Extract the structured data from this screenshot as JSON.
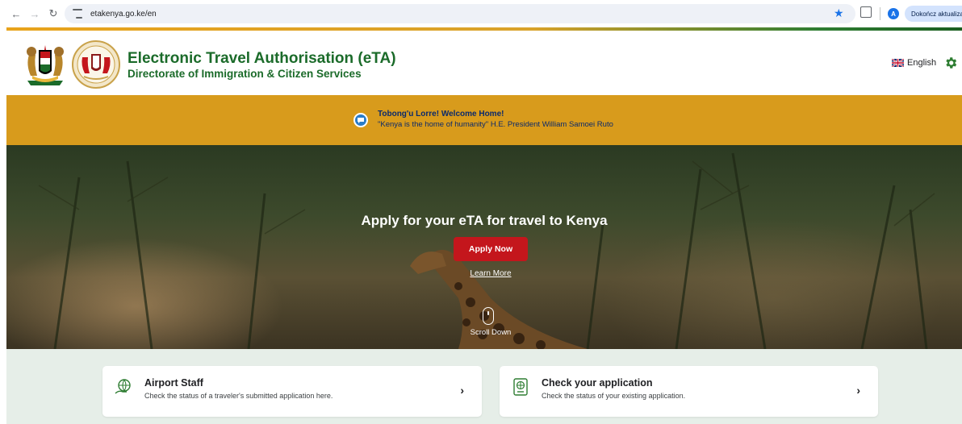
{
  "browser": {
    "url": "etakenya.go.ke/en",
    "update_button": "Dokończ aktualizację",
    "profile_initial": "A"
  },
  "header": {
    "title": "Electronic Travel Authorisation (eTA)",
    "subtitle": "Directorate of Immigration & Citizen Services",
    "language": "English"
  },
  "banner": {
    "title": "Tobong'u Lorre! Welcome Home!",
    "quote": "\"Kenya is the home of humanity\" H.E. President William Samoei Ruto"
  },
  "hero": {
    "title": "Apply for your eTA for travel to Kenya",
    "apply_label": "Apply Now",
    "learn_more_label": "Learn More",
    "scroll_label": "Scroll Down"
  },
  "cards": [
    {
      "title": "Airport Staff",
      "description": "Check the status of a traveler's submitted application here.",
      "icon": "globe-hand-icon"
    },
    {
      "title": "Check your application",
      "description": "Check the status of your existing application.",
      "icon": "passport-icon"
    }
  ],
  "colors": {
    "brand_green": "#1b6b2a",
    "banner_gold": "#d89b1c",
    "apply_red": "#c4161c",
    "cards_bg": "#e6eee8"
  }
}
